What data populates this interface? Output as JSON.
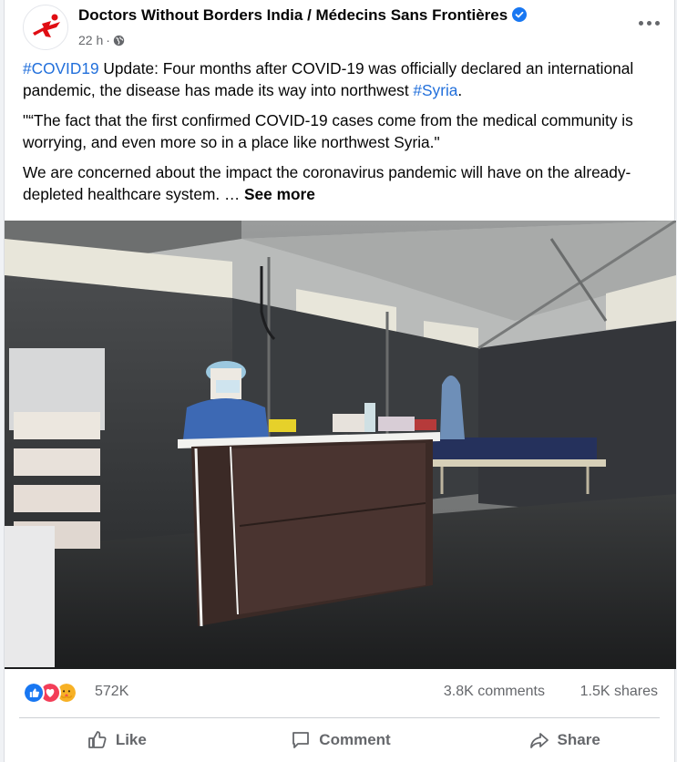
{
  "post": {
    "page_name": "Doctors Without Borders India / Médecins Sans Frontières",
    "time": "22 h",
    "separator": "·",
    "paragraphs": {
      "p1_tag1": "#COVID19",
      "p1_text": " Update: Four months after COVID-19 was officially declared an international pandemic, the disease has made its way into northwest ",
      "p1_tag2": "#Syria",
      "p1_end": ".",
      "p2": "\"“The fact that the first confirmed COVID-19 cases come from the medical community is worrying, and even more so in a place like northwest Syria.\"",
      "p3": "We are concerned about the impact the coronavirus pandemic will have on the already-depleted healthcare system. … ",
      "see_more": "See more"
    }
  },
  "stats": {
    "reactions_count": "572K",
    "comments": "3.8K comments",
    "shares": "1.5K shares",
    "reaction_icons": [
      "like-reaction-icon",
      "love-reaction-icon",
      "care-reaction-icon"
    ]
  },
  "actions": {
    "like": "Like",
    "comment": "Comment",
    "share": "Share"
  },
  "colors": {
    "link": "#216fdb",
    "like_blue": "#1877f2",
    "love_red": "#f33e58",
    "care_yellow": "#f7b125",
    "brand_red": "#e00d13"
  }
}
